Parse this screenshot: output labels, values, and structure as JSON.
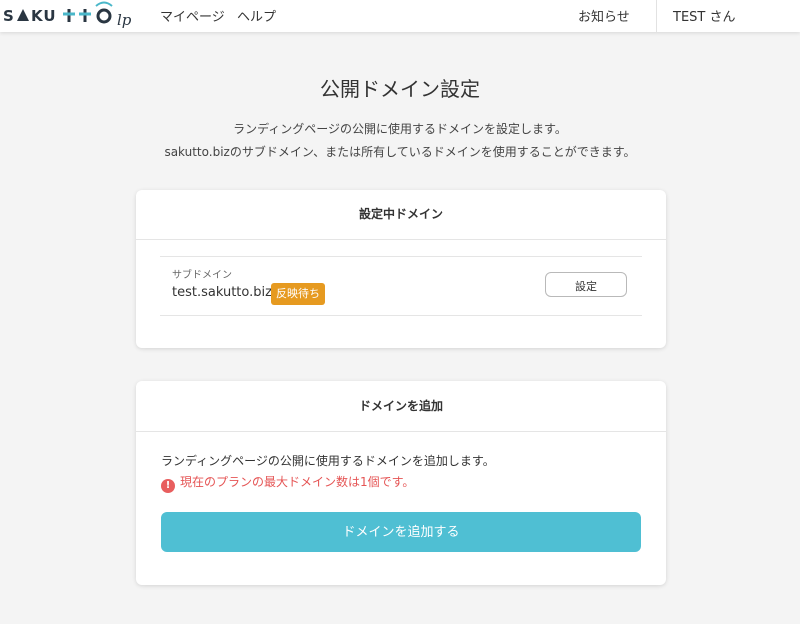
{
  "header": {
    "logo_text": "SAKUTTO lp",
    "nav": {
      "mypage": "マイページ",
      "help": "ヘルプ",
      "notice": "お知らせ",
      "user": "TEST さん"
    }
  },
  "page": {
    "title": "公開ドメイン設定",
    "description_line1": "ランディングページの公開に使用するドメインを設定します。",
    "description_line2": "sakutto.bizのサブドメイン、または所有しているドメインを使用することができます。"
  },
  "current_domain": {
    "heading": "設定中ドメイン",
    "type_label": "サブドメイン",
    "domain": "test.sakutto.biz",
    "status_badge": "反映待ち",
    "settings_button": "設定"
  },
  "add_domain": {
    "heading": "ドメインを追加",
    "description": "ランディングページの公開に使用するドメインを追加します。",
    "warning_icon": "!",
    "warning": "現在のプランの最大ドメイン数は1個です。",
    "button": "ドメインを追加する"
  },
  "colors": {
    "logo_dark": "#2a3642",
    "logo_teal": "#4ab7c9",
    "badge": "#e69a20",
    "warning": "#e55454",
    "primary_button": "#4fbfd3"
  },
  "icons": {
    "logo": "sakutto-lp-logo",
    "warning": "exclamation-circle-icon"
  }
}
